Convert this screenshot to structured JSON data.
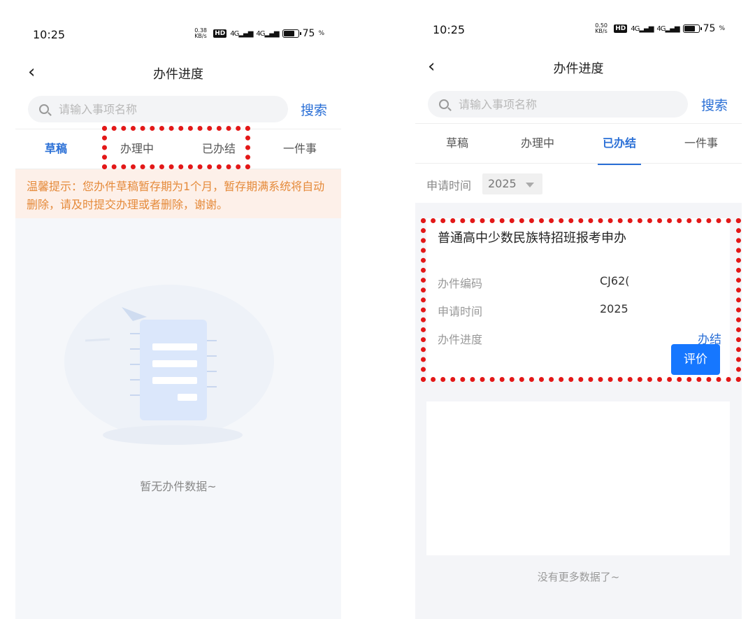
{
  "left_screen": {
    "status": {
      "time": "10:25",
      "speed": "0.38 KB/s",
      "network": "4G",
      "battery_pct": "75"
    },
    "nav": {
      "title": "办件进度"
    },
    "search": {
      "placeholder": "请输入事项名称",
      "button": "搜索"
    },
    "tabs": [
      "草稿",
      "办理中",
      "已办结",
      "一件事"
    ],
    "active_tab": "草稿",
    "notice": "温馨提示：您办件草稿暂存期为1个月，暂存期满系统将自动删除，请及时提交办理或者删除，谢谢。",
    "empty_text": "暂无办件数据~"
  },
  "right_screen": {
    "status": {
      "time": "10:25",
      "speed": "0.50 KB/s",
      "network": "4G",
      "battery_pct": "75"
    },
    "nav": {
      "title": "办件进度"
    },
    "search": {
      "placeholder": "请输入事项名称",
      "button": "搜索"
    },
    "tabs": [
      "草稿",
      "办理中",
      "已办结",
      "一件事"
    ],
    "active_tab": "已办结",
    "filter": {
      "label": "申请时间",
      "value": "2025"
    },
    "card": {
      "title": "普通高中少数民族特招班报考申办",
      "code_label": "办件编码",
      "code_value": "CJ62(",
      "time_label": "申请时间",
      "time_value": "2025",
      "progress_label": "办件进度",
      "progress_value": "办结",
      "button": "评价"
    },
    "nomore": "没有更多数据了~"
  },
  "colors": {
    "accent": "#2a6fd6",
    "button": "#1677ff",
    "highlight": "#e31818",
    "notice_text": "#e58a3a",
    "notice_bg": "#fdf0e9"
  }
}
